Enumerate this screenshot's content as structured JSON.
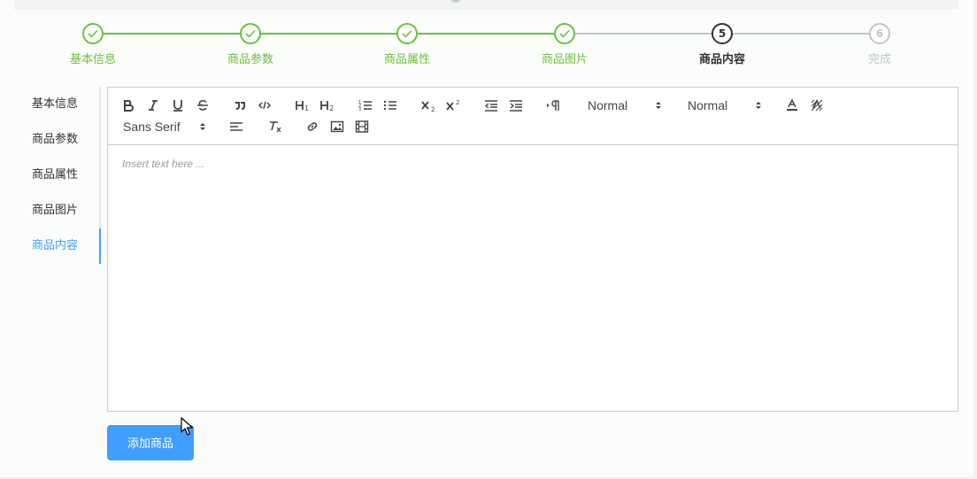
{
  "steps": [
    {
      "title": "基本信息",
      "status": "done",
      "icon": "check-icon"
    },
    {
      "title": "商品参数",
      "status": "done",
      "icon": "check-icon"
    },
    {
      "title": "商品属性",
      "status": "done",
      "icon": "check-icon"
    },
    {
      "title": "商品图片",
      "status": "done",
      "icon": "check-icon"
    },
    {
      "title": "商品内容",
      "status": "active",
      "number": "5"
    },
    {
      "title": "完成",
      "status": "wait",
      "number": "6"
    }
  ],
  "tabs": [
    "基本信息",
    "商品参数",
    "商品属性",
    "商品图片",
    "商品内容"
  ],
  "active_tab": "商品内容",
  "editor": {
    "header_select": "Normal",
    "size_select": "Normal",
    "font_select": "Sans Serif",
    "placeholder": "Insert text here ..."
  },
  "add_button": "添加商品",
  "colors": {
    "success": "#67c23a",
    "primary": "#409eff",
    "active": "#303133",
    "wait": "#c0c4cc"
  }
}
